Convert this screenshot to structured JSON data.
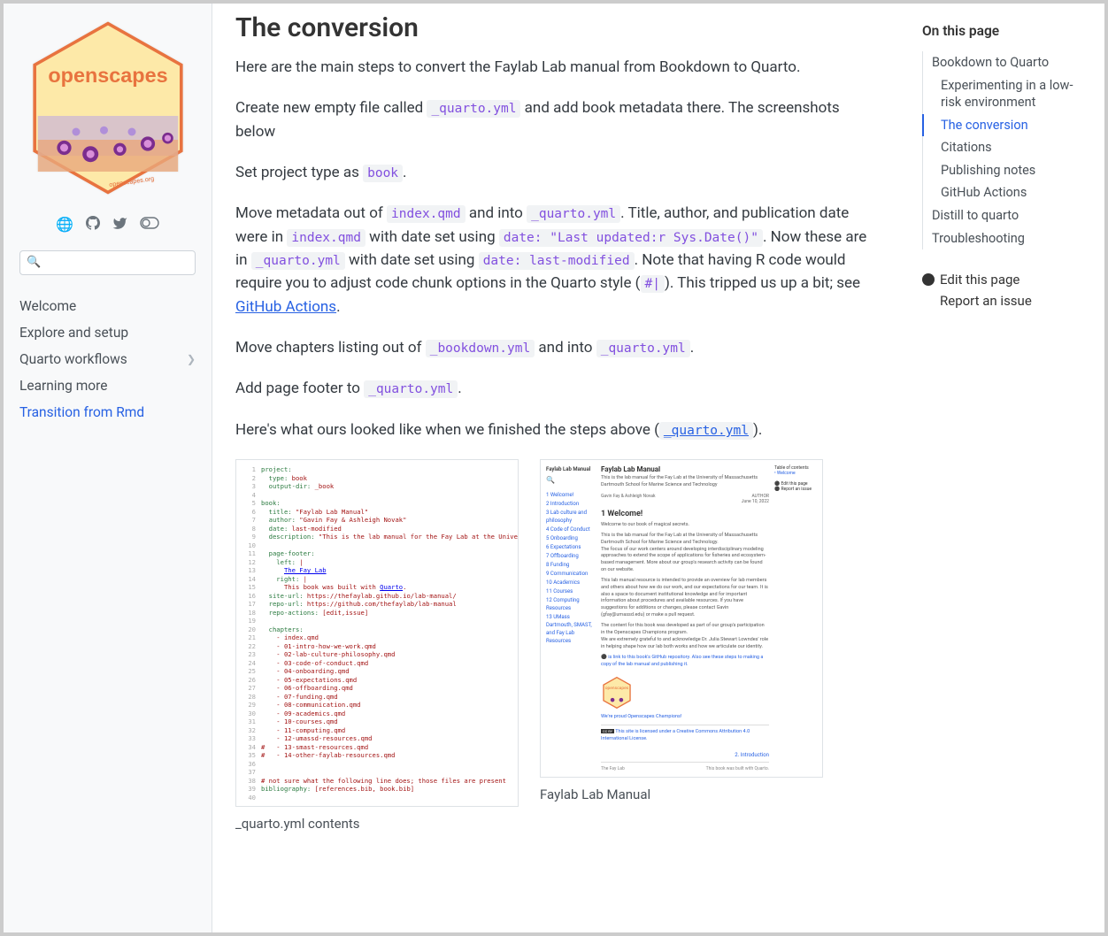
{
  "sidebar": {
    "logo_text": "openscapes",
    "logo_url": "openscapes.org",
    "search_placeholder": "",
    "nav": [
      {
        "label": "Welcome",
        "active": false,
        "expandable": false
      },
      {
        "label": "Explore and setup",
        "active": false,
        "expandable": false
      },
      {
        "label": "Quarto workflows",
        "active": false,
        "expandable": true
      },
      {
        "label": "Learning more",
        "active": false,
        "expandable": false
      },
      {
        "label": "Transition from Rmd",
        "active": true,
        "expandable": false
      }
    ]
  },
  "main": {
    "heading": "The conversion",
    "p1": "Here are the main steps to convert the Faylab Lab manual from Bookdown to Quarto.",
    "p2_a": "Create new empty file called ",
    "p2_code": "_quarto.yml",
    "p2_b": " and add book metadata there. The screenshots below",
    "p3_a": "Set project type as ",
    "p3_code": "book",
    "p3_b": ".",
    "p4_a": "Move metadata out of ",
    "p4_code1": "index.qmd",
    "p4_b": " and into ",
    "p4_code2": "_quarto.yml",
    "p4_c": ". Title, author, and publication date were in ",
    "p4_code3": "index.qmd",
    "p4_d": " with date set using ",
    "p4_code4": "date: \"Last updated:r Sys.Date()\"",
    "p4_e": ". Now these are in ",
    "p4_code5": "_quarto.yml",
    "p4_f": " with date set using ",
    "p4_code6": "date: last-modified",
    "p4_g": ". Note that having R code would require you to adjust code chunk options in the Quarto style (",
    "p4_code7": "#|",
    "p4_h": "). This tripped us up a bit; see ",
    "p4_link": "GitHub Actions",
    "p4_i": ".",
    "p5_a": "Move chapters listing out of ",
    "p5_code1": "_bookdown.yml",
    "p5_b": " and into ",
    "p5_code2": "_quarto.yml",
    "p5_c": ".",
    "p6_a": "Add page footer to ",
    "p6_code": "_quarto.yml",
    "p6_b": ".",
    "p7_a": "Here's what ours looked like when we finished the steps above (",
    "p7_link": "_quarto.yml",
    "p7_b": ").",
    "fig1_caption": "_quarto.yml contents",
    "fig2_caption": "Faylab Lab Manual",
    "codeblock": {
      "lines": [
        {
          "n": "1",
          "k": "project:",
          "v": ""
        },
        {
          "n": "2",
          "k": "  type:",
          "v": " book"
        },
        {
          "n": "3",
          "k": "  output-dir:",
          "v": " _book"
        },
        {
          "n": "4",
          "k": "",
          "v": ""
        },
        {
          "n": "5",
          "k": "book:",
          "v": ""
        },
        {
          "n": "6",
          "k": "  title:",
          "v": " \"Faylab Lab Manual\""
        },
        {
          "n": "7",
          "k": "  author:",
          "v": " \"Gavin Fay & Ashleigh Novak\""
        },
        {
          "n": "8",
          "k": "  date:",
          "v": " last-modified"
        },
        {
          "n": "9",
          "k": "  description:",
          "v": " \"This is the lab manual for the Fay Lab at the University of Massa"
        },
        {
          "n": "10",
          "k": "",
          "v": ""
        },
        {
          "n": "11",
          "k": "  page-footer:",
          "v": ""
        },
        {
          "n": "12",
          "k": "    left:",
          "v": " |"
        },
        {
          "n": "13",
          "k": "",
          "v": "      <a href=\"http://www.smast.umassd.edu/lab_fay/\">The Fay Lab</a>"
        },
        {
          "n": "14",
          "k": "    right:",
          "v": " |"
        },
        {
          "n": "15",
          "k": "",
          "v": "      This book was built with <a href=\"https://quarto.org/\">Quarto</a>."
        },
        {
          "n": "16",
          "k": "  site-url:",
          "v": " https://thefaylab.github.io/lab-manual/"
        },
        {
          "n": "17",
          "k": "  repo-url:",
          "v": " https://github.com/thefaylab/lab-manual"
        },
        {
          "n": "18",
          "k": "  repo-actions:",
          "v": " [edit,issue]"
        },
        {
          "n": "19",
          "k": "",
          "v": ""
        },
        {
          "n": "20",
          "k": "  chapters:",
          "v": ""
        },
        {
          "n": "21",
          "k": "",
          "v": "    - index.qmd"
        },
        {
          "n": "22",
          "k": "",
          "v": "    - 01-intro-how-we-work.qmd"
        },
        {
          "n": "23",
          "k": "",
          "v": "    - 02-lab-culture-philosophy.qmd"
        },
        {
          "n": "24",
          "k": "",
          "v": "    - 03-code-of-conduct.qmd"
        },
        {
          "n": "25",
          "k": "",
          "v": "    - 04-onboarding.qmd"
        },
        {
          "n": "26",
          "k": "",
          "v": "    - 05-expectations.qmd"
        },
        {
          "n": "27",
          "k": "",
          "v": "    - 06-offboarding.qmd"
        },
        {
          "n": "28",
          "k": "",
          "v": "    - 07-funding.qmd"
        },
        {
          "n": "29",
          "k": "",
          "v": "    - 08-communication.qmd"
        },
        {
          "n": "30",
          "k": "",
          "v": "    - 09-academics.qmd"
        },
        {
          "n": "31",
          "k": "",
          "v": "    - 10-courses.qmd"
        },
        {
          "n": "32",
          "k": "",
          "v": "    - 11-computing.qmd"
        },
        {
          "n": "33",
          "k": "",
          "v": "    - 12-umassd-resources.qmd"
        },
        {
          "n": "34",
          "k": "",
          "v": "#   - 13-smast-resources.qmd"
        },
        {
          "n": "35",
          "k": "",
          "v": "#   - 14-other-faylab-resources.qmd"
        },
        {
          "n": "36",
          "k": "",
          "v": ""
        },
        {
          "n": "37",
          "k": "",
          "v": ""
        },
        {
          "n": "38",
          "k": "",
          "v": "# not sure what the following line does; those files are present"
        },
        {
          "n": "39",
          "k": "bibliography:",
          "v": " [references.bib, book.bib]"
        },
        {
          "n": "40",
          "k": "",
          "v": ""
        }
      ]
    },
    "browser": {
      "title_small": "Faylab Lab Manual",
      "title": "Faylab Lab Manual",
      "subtitle": "This is the lab manual for the Fay Lab at the University of Massachusetts Dartmouth School for Marine Science and Technology",
      "authors": "Gavin Fay & Ashleigh Novak",
      "date": "AUTHOR\nJune 10, 2022",
      "welcome": "1 Welcome!",
      "welcome_p1": "Welcome to our book of magical secrets.",
      "welcome_p2": "This is the lab manual for the Fay Lab at the University of Massachusetts Dartmouth School for Marine Science and Technology.\nThe focus of our work centers around developing interdisciplinary modeling approaches to extend the scope of applications for fisheries and ecosystem-based management. More about our group's research activity can be found on our website.",
      "welcome_p3": "This lab manual resource is intended to provide an overview for lab members and others about how we do our work, and our expectations for our team. It is also a space to document institutional knowledge and for important information about procedures and available resources. If you have suggestions for additions or changes, please contact Gavin (gfay@umassd.edu) or make a pull request.",
      "welcome_p4": "The content for this book was developed as part of our group's participation in the Openscapes Champions program.\nWe are extremely grateful to and acknowledge Dr. Julia Stewart Lowndes' role in helping shape how our lab both works and how we articulate our identity.",
      "gh_note": "is link to this book's GitHub repository. Also see these steps to making a copy of the lab manual and publishing it.",
      "champions": "We're proud Openscapes Champions!",
      "license": "This site is licensed under a Creative Commons Attribution 4.0 International License.",
      "nav_link": "2. Introduction",
      "footer_left": "The Fay Lab",
      "footer_right": "This book was built with Quarto.",
      "toc_title": "Table of contents",
      "toc": [
        "1 Welcome!",
        "2 Introduction",
        "3 Lab culture and philosophy",
        "4 Code of Conduct",
        "5 Onboarding",
        "6 Expectations",
        "7 Offboarding",
        "8 Funding",
        "9 Communication",
        "10 Academics",
        "11 Courses",
        "12 Computing Resources",
        "13 UMass Dartmouth, SMAST, and Fay Lab Resources"
      ],
      "right_toc": [
        "Welcome"
      ],
      "right_actions": [
        "Edit this page",
        "Report an issue"
      ]
    }
  },
  "rightbar": {
    "heading": "On this page",
    "items": [
      {
        "label": "Bookdown to Quarto",
        "level": 1,
        "active": false
      },
      {
        "label": "Experimenting in a low-risk environment",
        "level": 2,
        "active": false
      },
      {
        "label": "The conversion",
        "level": 2,
        "active": true
      },
      {
        "label": "Citations",
        "level": 2,
        "active": false
      },
      {
        "label": "Publishing notes",
        "level": 2,
        "active": false
      },
      {
        "label": "GitHub Actions",
        "level": 2,
        "active": false
      },
      {
        "label": "Distill to quarto",
        "level": 1,
        "active": false
      },
      {
        "label": "Troubleshooting",
        "level": 1,
        "active": false
      }
    ],
    "edit": "Edit this page",
    "report": "Report an issue"
  }
}
